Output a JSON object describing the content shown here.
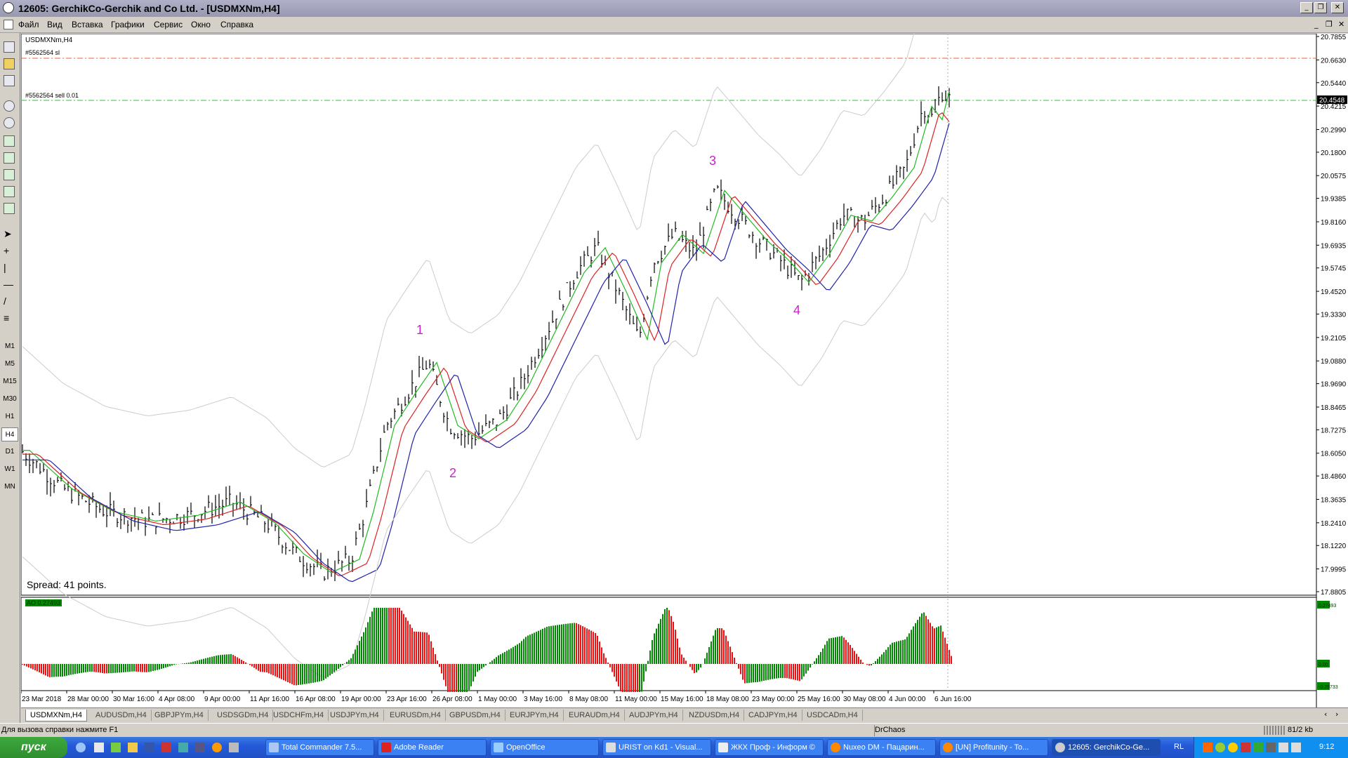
{
  "window": {
    "title": "12605: GerchikCo-Gerchik and Co Ltd. - [USDMXNm,H4]"
  },
  "menu": [
    "Файл",
    "Вид",
    "Вставка",
    "Графики",
    "Сервис",
    "Окно",
    "Справка"
  ],
  "timeframes": [
    "M1",
    "M5",
    "M15",
    "M30",
    "H1",
    "H4",
    "D1",
    "W1",
    "MN"
  ],
  "chart": {
    "symbol_label": "USDMXNm,H4",
    "sl_label": "#5562564 sl",
    "order_label": "#5562564 sell 0.01",
    "spread": "Spread: 41 points.",
    "wave_labels": [
      "1",
      "2",
      "3",
      "4"
    ],
    "current_price": "20.4548",
    "price_ticks": [
      "20.7855",
      "20.6630",
      "20.5440",
      "20.4215",
      "20.2990",
      "20.1800",
      "20.0575",
      "19.9385",
      "19.8160",
      "19.6935",
      "19.5745",
      "19.4520",
      "19.3330",
      "19.2105",
      "19.0880",
      "18.9690",
      "18.8465",
      "18.7275",
      "18.6050",
      "18.4860",
      "18.3635",
      "18.2410",
      "18.1220",
      "17.9995",
      "17.8805"
    ],
    "date_ticks": [
      "23 Mar 2018",
      "28 Mar 00:00",
      "30 Mar 16:00",
      "4 Apr 08:00",
      "9 Apr 00:00",
      "11 Apr 16:00",
      "16 Apr 08:00",
      "19 Apr 00:00",
      "23 Apr 16:00",
      "26 Apr 08:00",
      "1 May 00:00",
      "3 May 16:00",
      "8 May 08:00",
      "11 May 00:00",
      "15 May 16:00",
      "18 May 08:00",
      "23 May 00:00",
      "25 May 16:00",
      "30 May 08:00",
      "4 Jun 00:00",
      "6 Jun 16:00"
    ],
    "ao_label": "AO 0.27493",
    "ao_scale": [
      "0.27493",
      "0.00",
      "-0.29733"
    ],
    "colors": {
      "sl_line": "#e8603c",
      "order_line": "#3cbc3c",
      "ma_fast": "#22bb22",
      "ma_mid": "#dd2222",
      "ma_slow": "#2222aa",
      "ao_up": "#008800",
      "ao_down": "#ee1111",
      "wave": "#cc22cc"
    }
  },
  "tabs": [
    "USDMXNm,H4",
    "AUDUSDm,H4",
    "GBPJPYm,H4",
    "USDSGDm,H4",
    "USDCHFm,H4",
    "USDJPYm,H4",
    "EURUSDm,H4",
    "GBPUSDm,H4",
    "EURJPYm,H4",
    "EURAUDm,H4",
    "AUDJPYm,H4",
    "NZDUSDm,H4",
    "CADJPYm,H4",
    "USDCADm,H4"
  ],
  "status": {
    "help": "Для вызова справки нажмите F1",
    "profile": "DrChaos",
    "traffic": "81/2 kb"
  },
  "taskbar": {
    "start": "пуск",
    "tasks": [
      "Total Commander 7.5...",
      "Adobe Reader",
      "OpenOffice",
      "URIST on Kd1 - Visual...",
      "ЖКХ Проф - Информ ©",
      "Nuxeo DM - Пацарин...",
      "[UN] Profitunity - To...",
      "12605: GerchikCo-Ge..."
    ],
    "lang": "RL",
    "clock": "9:12"
  }
}
